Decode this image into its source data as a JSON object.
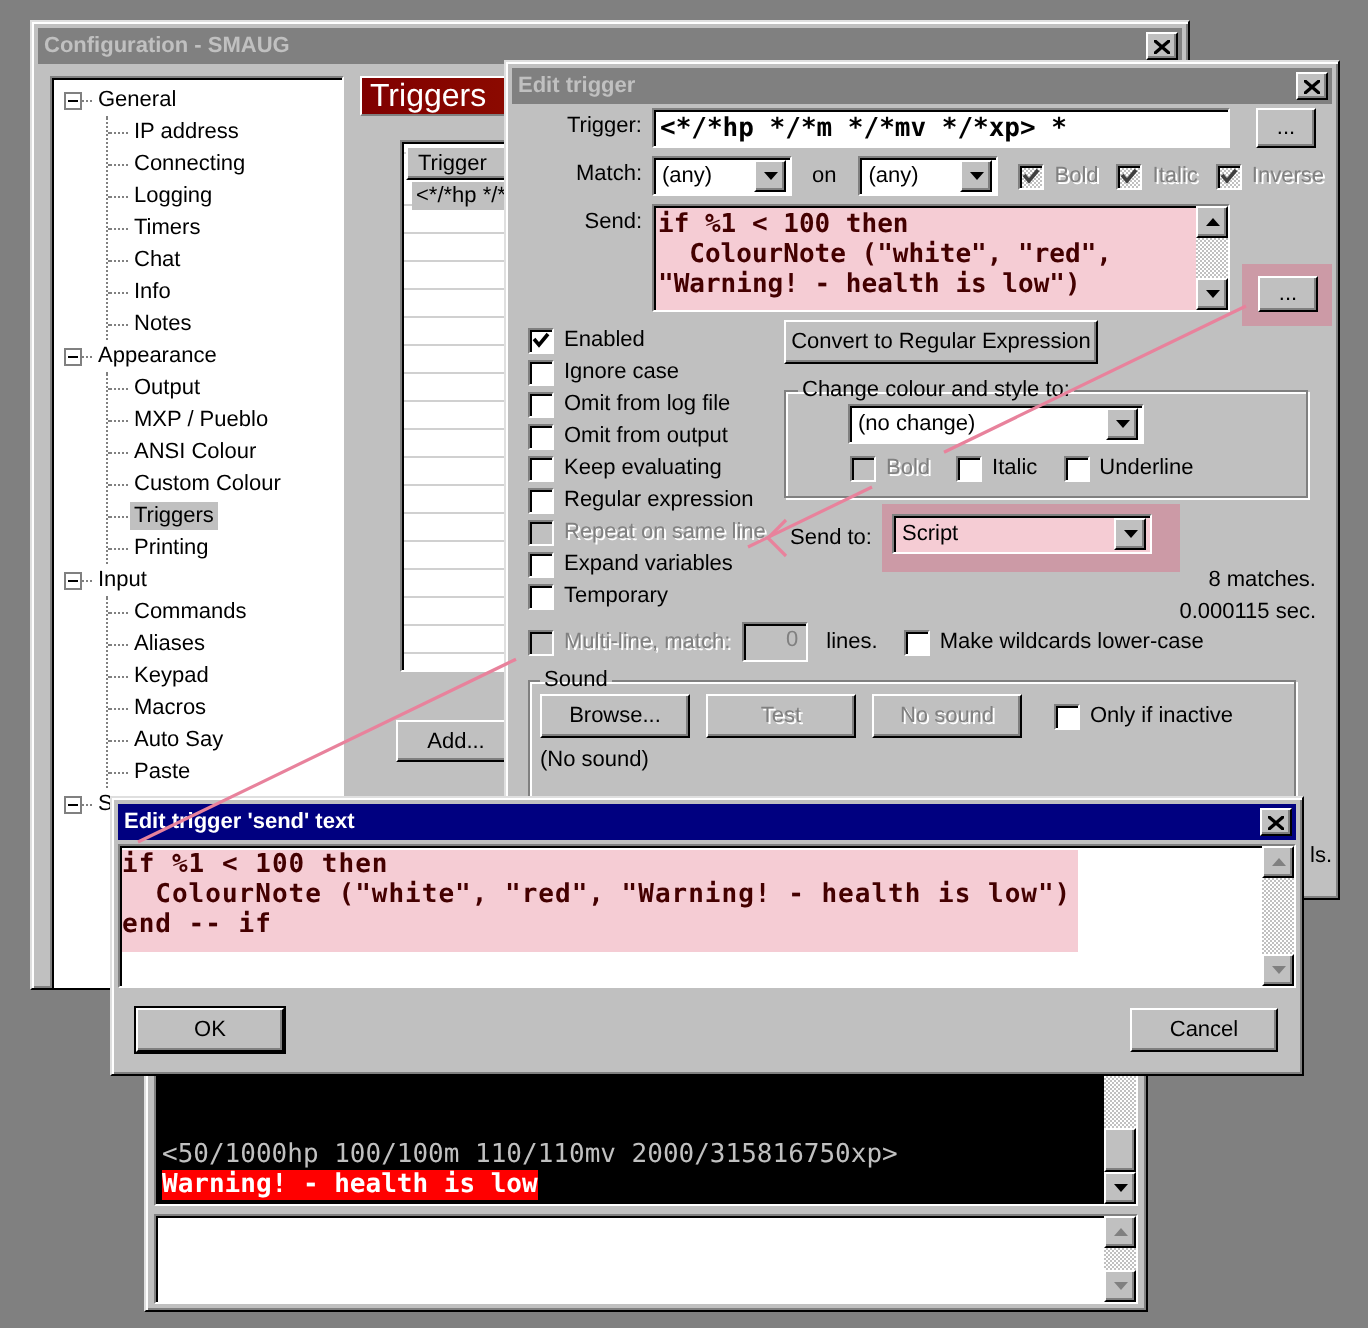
{
  "config_window": {
    "title": "Configuration - SMAUG",
    "active": false,
    "tree": [
      {
        "label": "General",
        "expanded": true,
        "selected": false,
        "children": [
          {
            "label": "IP address",
            "selected": false
          },
          {
            "label": "Connecting",
            "selected": false
          },
          {
            "label": "Logging",
            "selected": false
          },
          {
            "label": "Timers",
            "selected": false
          },
          {
            "label": "Chat",
            "selected": false
          },
          {
            "label": "Info",
            "selected": false
          },
          {
            "label": "Notes",
            "selected": false
          }
        ]
      },
      {
        "label": "Appearance",
        "expanded": true,
        "selected": false,
        "children": [
          {
            "label": "Output",
            "selected": false
          },
          {
            "label": "MXP / Pueblo",
            "selected": false
          },
          {
            "label": "ANSI Colour",
            "selected": false
          },
          {
            "label": "Custom Colour",
            "selected": false
          },
          {
            "label": "Triggers",
            "selected": true
          },
          {
            "label": "Printing",
            "selected": false
          }
        ]
      },
      {
        "label": "Input",
        "expanded": true,
        "selected": false,
        "children": [
          {
            "label": "Commands",
            "selected": false
          },
          {
            "label": "Aliases",
            "selected": false
          },
          {
            "label": "Keypad",
            "selected": false
          },
          {
            "label": "Macros",
            "selected": false
          },
          {
            "label": "Auto Say",
            "selected": false
          },
          {
            "label": "Paste",
            "selected": false
          }
        ]
      },
      {
        "label": "S",
        "expanded": true,
        "selected": false
      }
    ],
    "panel_title": "Triggers",
    "list": {
      "columns": [
        "Trigger"
      ],
      "rows": [
        {
          "cells": [
            "<*/*hp */*"
          ],
          "selected": true
        }
      ]
    },
    "add_button": "Add..."
  },
  "trigger_dialog": {
    "title": "Edit trigger",
    "active": false,
    "trigger": {
      "label": "Trigger:",
      "value": "<*/*hp */*m */*mv */*xp> *",
      "button": "..."
    },
    "match": {
      "label": "Match:",
      "value": "(any)",
      "on_label": "on",
      "on_value": "(any)",
      "styles": [
        {
          "label": "Bold",
          "checked": true,
          "disabled": true
        },
        {
          "label": "Italic",
          "checked": true,
          "disabled": true
        },
        {
          "label": "Inverse",
          "checked": true,
          "disabled": true
        }
      ]
    },
    "send": {
      "label": "Send:",
      "lines": [
        "if %1 < 100 then",
        "  ColourNote (\"white\", \"red\",",
        "\"Warning! - health is low\")"
      ],
      "button": {
        "label": "...",
        "highlighted": true
      }
    },
    "options": [
      {
        "label": "Enabled",
        "checked": true,
        "disabled": false
      },
      {
        "label": "Ignore case",
        "checked": false,
        "disabled": false
      },
      {
        "label": "Omit from log file",
        "checked": false,
        "disabled": false
      },
      {
        "label": "Omit from output",
        "checked": false,
        "disabled": false
      },
      {
        "label": "Keep evaluating",
        "checked": false,
        "disabled": false
      },
      {
        "label": "Regular expression",
        "checked": false,
        "disabled": false
      },
      {
        "label": "Repeat on same line",
        "checked": false,
        "disabled": true
      },
      {
        "label": "Expand variables",
        "checked": false,
        "disabled": false
      },
      {
        "label": "Temporary",
        "checked": false,
        "disabled": false
      }
    ],
    "convert_button": "Convert to Regular Expression",
    "colour_group": {
      "title": "Change colour and style to:",
      "value": "(no change)",
      "styles": [
        {
          "label": "Bold",
          "checked": false,
          "disabled": true
        },
        {
          "label": "Italic",
          "checked": false,
          "disabled": false
        },
        {
          "label": "Underline",
          "checked": false,
          "disabled": false
        }
      ]
    },
    "send_to": {
      "label": "Send to:",
      "value": "Script",
      "highlighted": true
    },
    "matches": "8 matches.",
    "time": "0.000115 sec.",
    "multiline": {
      "label": "Multi-line, match:",
      "checked": false,
      "disabled": true,
      "value": "0",
      "suffix": "lines."
    },
    "lowercase": {
      "label": "Make wildcards lower-case",
      "checked": false
    },
    "sound": {
      "title": "Sound",
      "buttons": [
        {
          "label": "Browse...",
          "disabled": false
        },
        {
          "label": "Test",
          "disabled": true
        },
        {
          "label": "No sound",
          "disabled": true
        }
      ],
      "inactive": {
        "label": "Only if inactive",
        "checked": false
      },
      "status": "(No sound)"
    },
    "fragment": "ls."
  },
  "send_dialog": {
    "title": "Edit trigger 'send' text",
    "active": true,
    "lines": [
      "if %1 < 100 then",
      "  ColourNote (\"white\", \"red\", \"Warning! - health is low\")",
      "end -- if"
    ],
    "buttons": [
      {
        "label": "OK",
        "default": true
      },
      {
        "label": "Cancel",
        "default": false
      }
    ]
  },
  "terminal": {
    "lines": [
      {
        "kind": "output",
        "text": "<50/1000hp 100/100m 110/110mv 2000/315816750xp>"
      },
      {
        "kind": "alert",
        "text": "Warning! - health is low"
      }
    ]
  }
}
